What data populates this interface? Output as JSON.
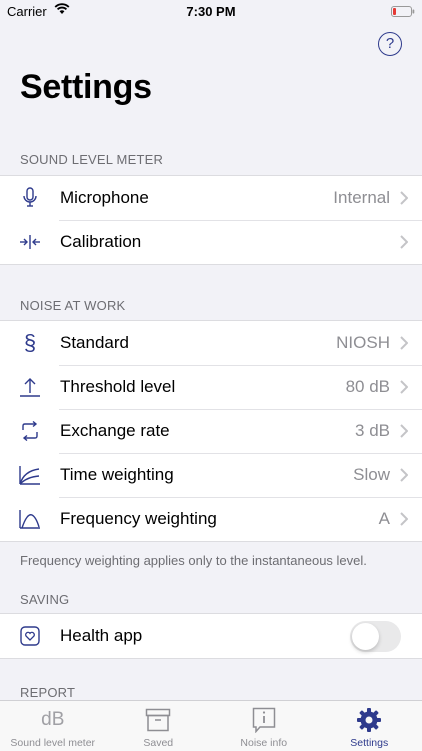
{
  "status_bar": {
    "carrier": "Carrier",
    "time": "7:30 PM"
  },
  "page": {
    "title": "Settings"
  },
  "sections": {
    "sound_level_meter": {
      "header": "SOUND LEVEL METER",
      "rows": [
        {
          "label": "Microphone",
          "value": "Internal",
          "icon": "microphone-icon"
        },
        {
          "label": "Calibration",
          "value": "",
          "icon": "calibration-icon"
        }
      ]
    },
    "noise_at_work": {
      "header": "NOISE AT WORK",
      "rows": [
        {
          "label": "Standard",
          "value": "NIOSH",
          "icon": "section-sign-icon"
        },
        {
          "label": "Threshold level",
          "value": "80 dB",
          "icon": "threshold-icon"
        },
        {
          "label": "Exchange rate",
          "value": "3 dB",
          "icon": "exchange-icon"
        },
        {
          "label": "Time weighting",
          "value": "Slow",
          "icon": "time-weighting-icon"
        },
        {
          "label": "Frequency weighting",
          "value": "A",
          "icon": "frequency-weighting-icon"
        }
      ],
      "footer": "Frequency weighting applies only to the instantaneous level."
    },
    "saving": {
      "header": "SAVING",
      "rows": [
        {
          "label": "Health app",
          "toggle": false,
          "icon": "health-app-icon"
        }
      ]
    },
    "report": {
      "header": "REPORT"
    }
  },
  "tab_bar": {
    "tabs": [
      {
        "label": "Sound level meter",
        "icon_text": "dB",
        "icon": "db-icon",
        "active": false
      },
      {
        "label": "Saved",
        "icon": "archive-box-icon",
        "active": false
      },
      {
        "label": "Noise info",
        "icon": "info-icon",
        "active": false
      },
      {
        "label": "Settings",
        "icon": "gear-icon",
        "active": true
      }
    ]
  },
  "colors": {
    "accent": "#2e3a8c",
    "secondary_text": "#8e8e93",
    "background": "#f2f2f7"
  }
}
